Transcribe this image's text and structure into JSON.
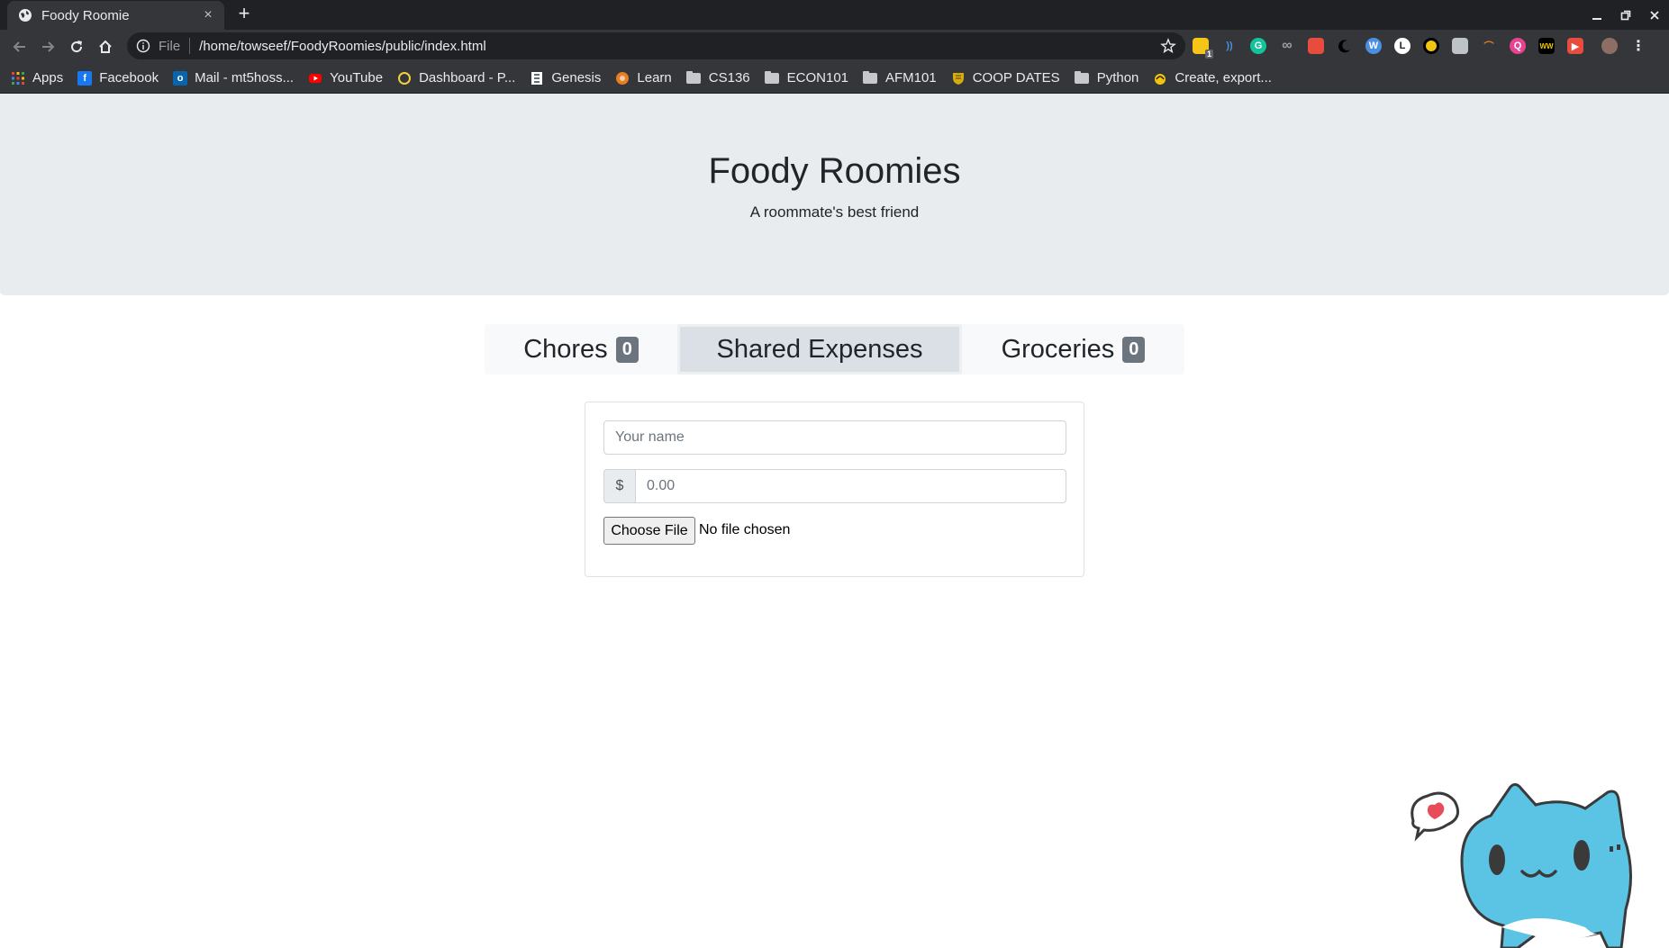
{
  "browser": {
    "tab_title": "Foody Roomie",
    "new_tab_symbol": "+",
    "close_symbol": "×",
    "address_scheme": "File",
    "address_url": "/home/towseef/FoodyRoomies/public/index.html",
    "extension_badge": "1",
    "bookmarks": [
      {
        "label": "Apps",
        "icon": "apps-grid-icon",
        "color": "#ea4335"
      },
      {
        "label": "Facebook",
        "icon": "facebook-icon",
        "color": "#1877f2",
        "glyph": "f"
      },
      {
        "label": "Mail - mt5hoss...",
        "icon": "outlook-icon",
        "color": "#0a64ad",
        "glyph": "o"
      },
      {
        "label": "YouTube",
        "icon": "youtube-icon",
        "color": "#ff0000"
      },
      {
        "label": "Dashboard - P...",
        "icon": "dashboard-icon",
        "color": "#f4d03f"
      },
      {
        "label": "Genesis",
        "icon": "genesis-icon",
        "color": "#ffffff"
      },
      {
        "label": "Learn",
        "icon": "learn-icon",
        "color": "#e67e22"
      },
      {
        "label": "CS136",
        "icon": "folder-icon"
      },
      {
        "label": "ECON101",
        "icon": "folder-icon"
      },
      {
        "label": "AFM101",
        "icon": "folder-icon"
      },
      {
        "label": "COOP DATES",
        "icon": "shield-crest-icon",
        "color": "#d4ac0d"
      },
      {
        "label": "Python",
        "icon": "folder-icon"
      },
      {
        "label": "Create, export...",
        "icon": "create-export-icon",
        "color": "#f1c40f"
      }
    ]
  },
  "header": {
    "title": "Foody Roomies",
    "subtitle": "A roommate's best friend"
  },
  "tabs": [
    {
      "label": "Chores",
      "badge": "0"
    },
    {
      "label": "Shared Expenses"
    },
    {
      "label": "Groceries",
      "badge": "0"
    }
  ],
  "form": {
    "name_placeholder": "Your name",
    "currency_symbol": "$",
    "amount_placeholder": "0.00",
    "file_button_label": "Choose File",
    "file_status": "No file chosen"
  },
  "colors": {
    "jumbotron_bg": "#e9ecef",
    "active_tab_bg": "#dae0e5",
    "badge_bg": "#6c757d",
    "mascot_blue": "#5bc4e5"
  }
}
